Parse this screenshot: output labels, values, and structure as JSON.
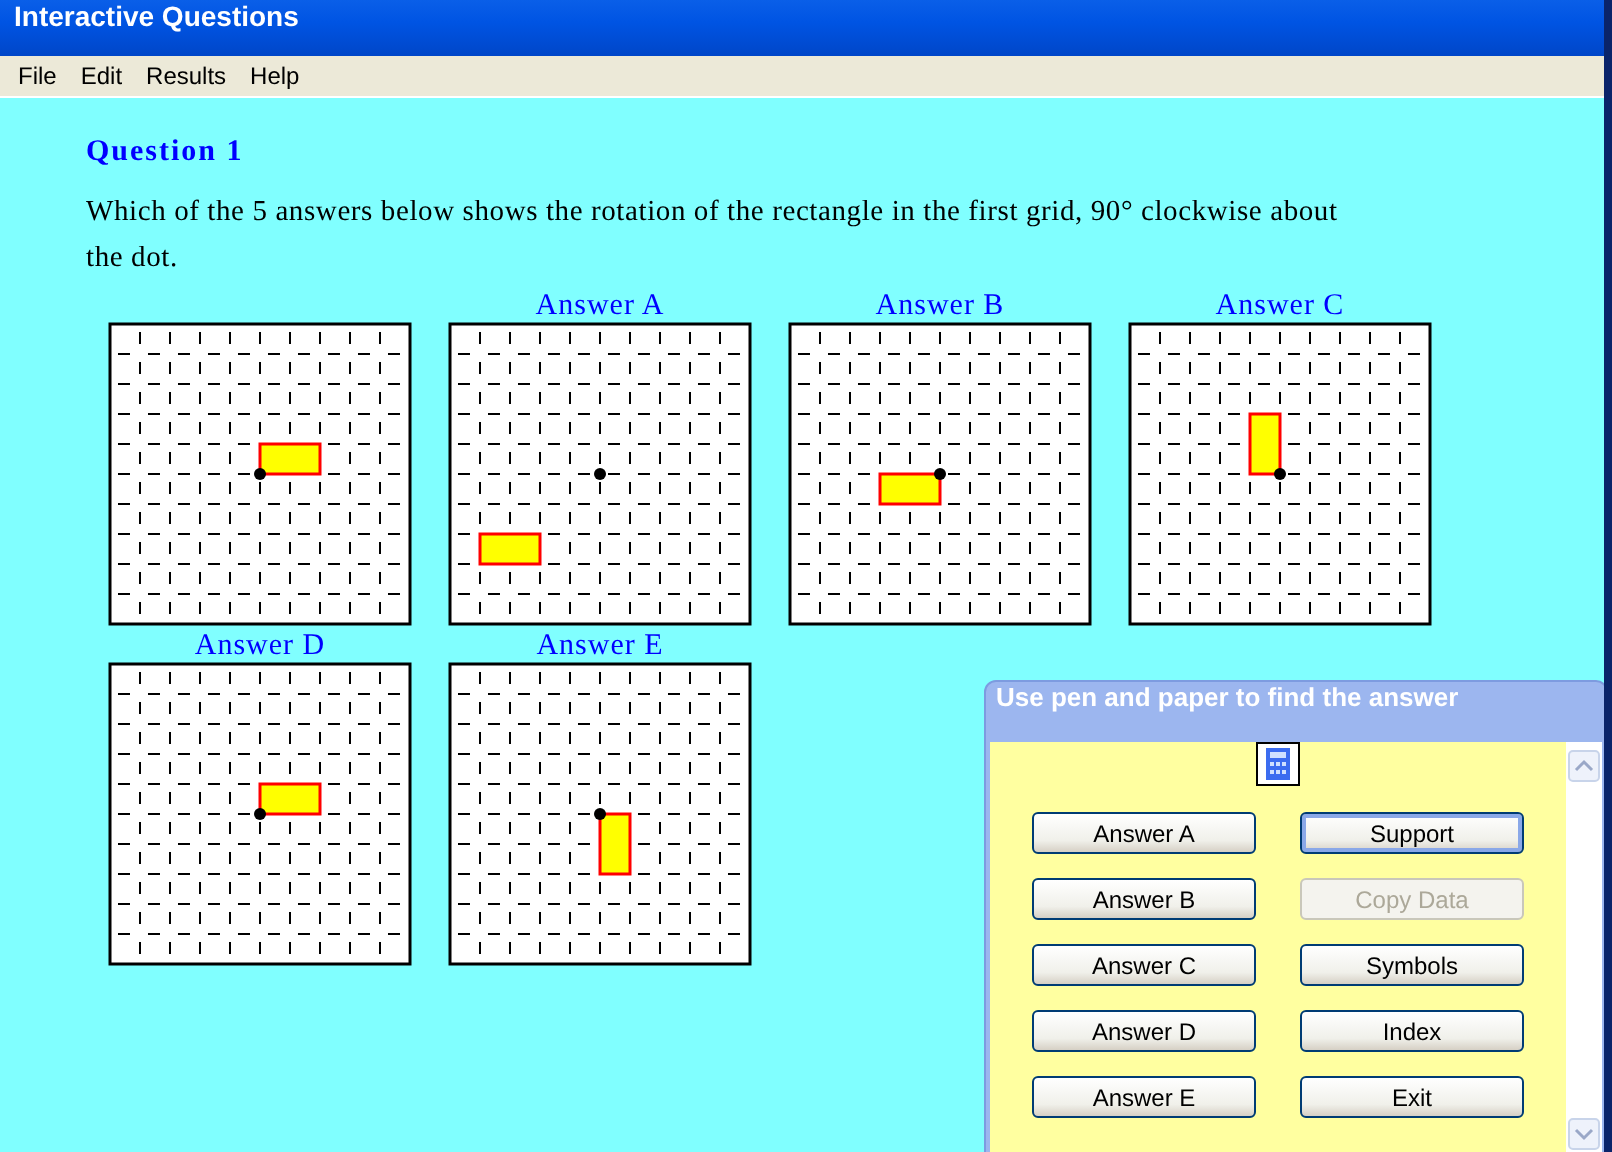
{
  "window": {
    "title": "Interactive Questions"
  },
  "menu": [
    "File",
    "Edit",
    "Results",
    "Help"
  ],
  "question": {
    "title": "Question 1",
    "text": "Which of the 5 answers below shows the rotation of the rectangle in the first grid, 90° clockwise about the dot."
  },
  "grids": [
    {
      "kind": "question"
    },
    {
      "kind": "answer",
      "label": "Answer A"
    },
    {
      "kind": "answer",
      "label": "Answer B"
    },
    {
      "kind": "answer",
      "label": "Answer C"
    },
    {
      "kind": "answer",
      "label": "Answer D"
    },
    {
      "kind": "answer",
      "label": "Answer E"
    }
  ],
  "panel": {
    "title": "Use pen and paper to find the answer",
    "buttons": [
      {
        "label": "Answer A",
        "disabled": false,
        "focused": false
      },
      {
        "label": "Support",
        "disabled": false,
        "focused": true
      },
      {
        "label": "Answer B",
        "disabled": false,
        "focused": false
      },
      {
        "label": "Copy Data",
        "disabled": true,
        "focused": false
      },
      {
        "label": "Answer C",
        "disabled": false,
        "focused": false
      },
      {
        "label": "Symbols",
        "disabled": false,
        "focused": false
      },
      {
        "label": "Answer D",
        "disabled": false,
        "focused": false
      },
      {
        "label": "Index",
        "disabled": false,
        "focused": false
      },
      {
        "label": "Answer E",
        "disabled": false,
        "focused": false
      },
      {
        "label": "Exit",
        "disabled": false,
        "focused": false
      }
    ]
  }
}
